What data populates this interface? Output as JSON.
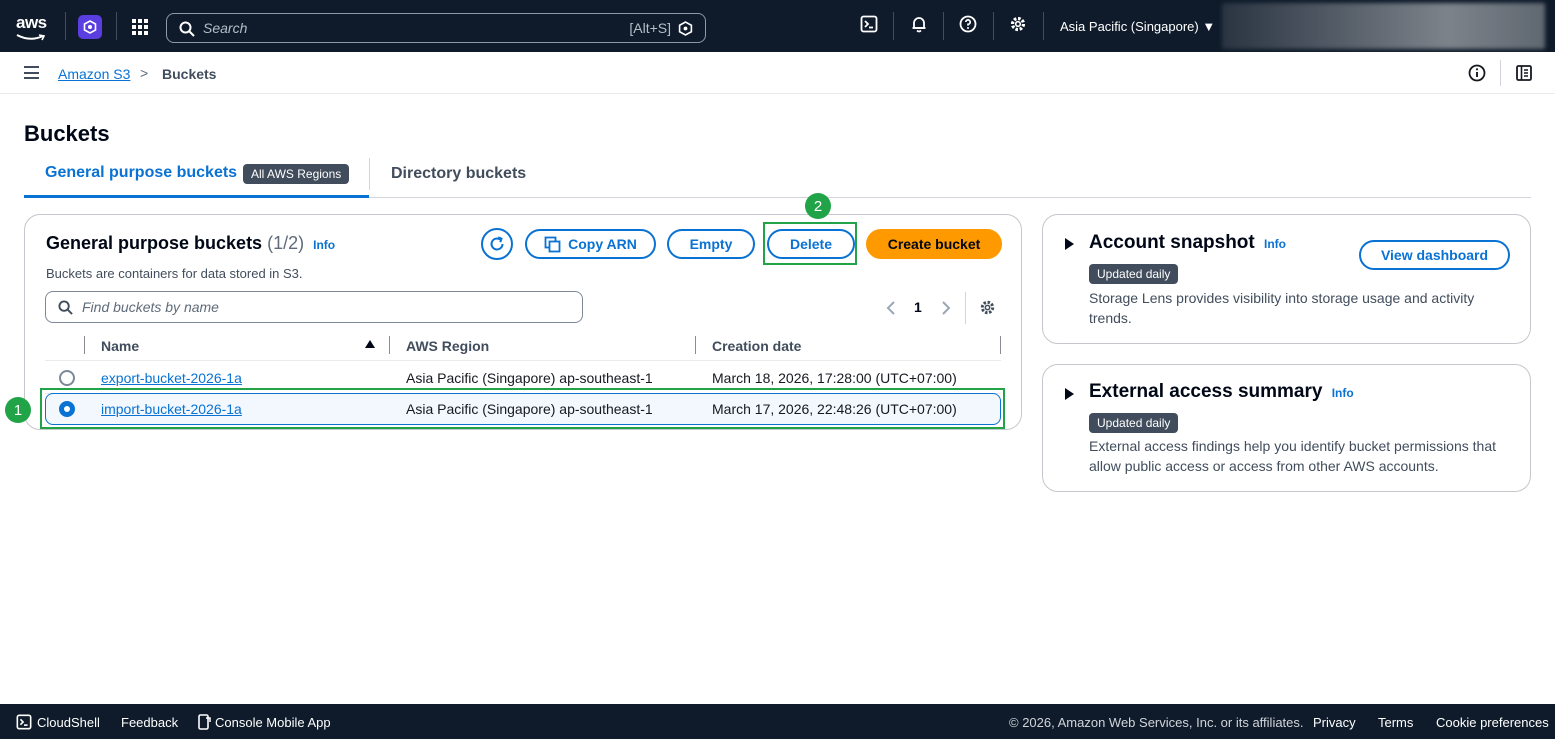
{
  "topnav": {
    "logo_text": "aws",
    "search_placeholder": "Search",
    "search_shortcut": "[Alt+S]",
    "region": "Asia Pacific (Singapore) ▼",
    "icons": [
      "grid-icon",
      "cloudshell-icon",
      "bell-icon",
      "help-icon",
      "gear-icon"
    ]
  },
  "breadcrumb": {
    "home": "Amazon S3",
    "separator": ">",
    "current": "Buckets"
  },
  "page": {
    "title": "Buckets"
  },
  "tabs": [
    {
      "label": "General purpose buckets",
      "badge": "All AWS Regions",
      "active": true
    },
    {
      "label": "Directory buckets",
      "active": false
    }
  ],
  "panel": {
    "title": "General purpose buckets",
    "count": "(1/2)",
    "info": "Info",
    "description": "Buckets are containers for data stored in S3.",
    "buttons": {
      "copy_arn": "Copy ARN",
      "empty": "Empty",
      "delete": "Delete",
      "create": "Create bucket"
    },
    "search_placeholder": "Find buckets by name",
    "page_number": "1",
    "columns": [
      "Name",
      "AWS Region",
      "Creation date"
    ],
    "rows": [
      {
        "name": "export-bucket-2026-1a",
        "region": "Asia Pacific (Singapore) ap-southeast-1",
        "created": "March 18, 2026, 17:28:00 (UTC+07:00)",
        "selected": false
      },
      {
        "name": "import-bucket-2026-1a",
        "region": "Asia Pacific (Singapore) ap-southeast-1",
        "created": "March 17, 2026, 22:48:26 (UTC+07:00)",
        "selected": true
      }
    ]
  },
  "snapshot": {
    "title": "Account snapshot",
    "info": "Info",
    "badge": "Updated daily",
    "description": "Storage Lens provides visibility into storage usage and activity trends.",
    "button": "View dashboard"
  },
  "external": {
    "title": "External access summary",
    "info": "Info",
    "badge": "Updated daily",
    "description": "External access findings help you identify bucket permissions that allow public access or access from other AWS accounts."
  },
  "annotations": {
    "step1": "1",
    "step2": "2",
    "color": "#21a347"
  },
  "footer": {
    "cloudshell": "CloudShell",
    "feedback": "Feedback",
    "mobile": "Console Mobile App",
    "copyright": "© 2026, Amazon Web Services, Inc. or its affiliates.",
    "privacy": "Privacy",
    "terms": "Terms",
    "cookies": "Cookie preferences"
  },
  "colors": {
    "nav_bg": "#0f1b2a",
    "link": "#0972d3",
    "primary": "#ff9900"
  }
}
